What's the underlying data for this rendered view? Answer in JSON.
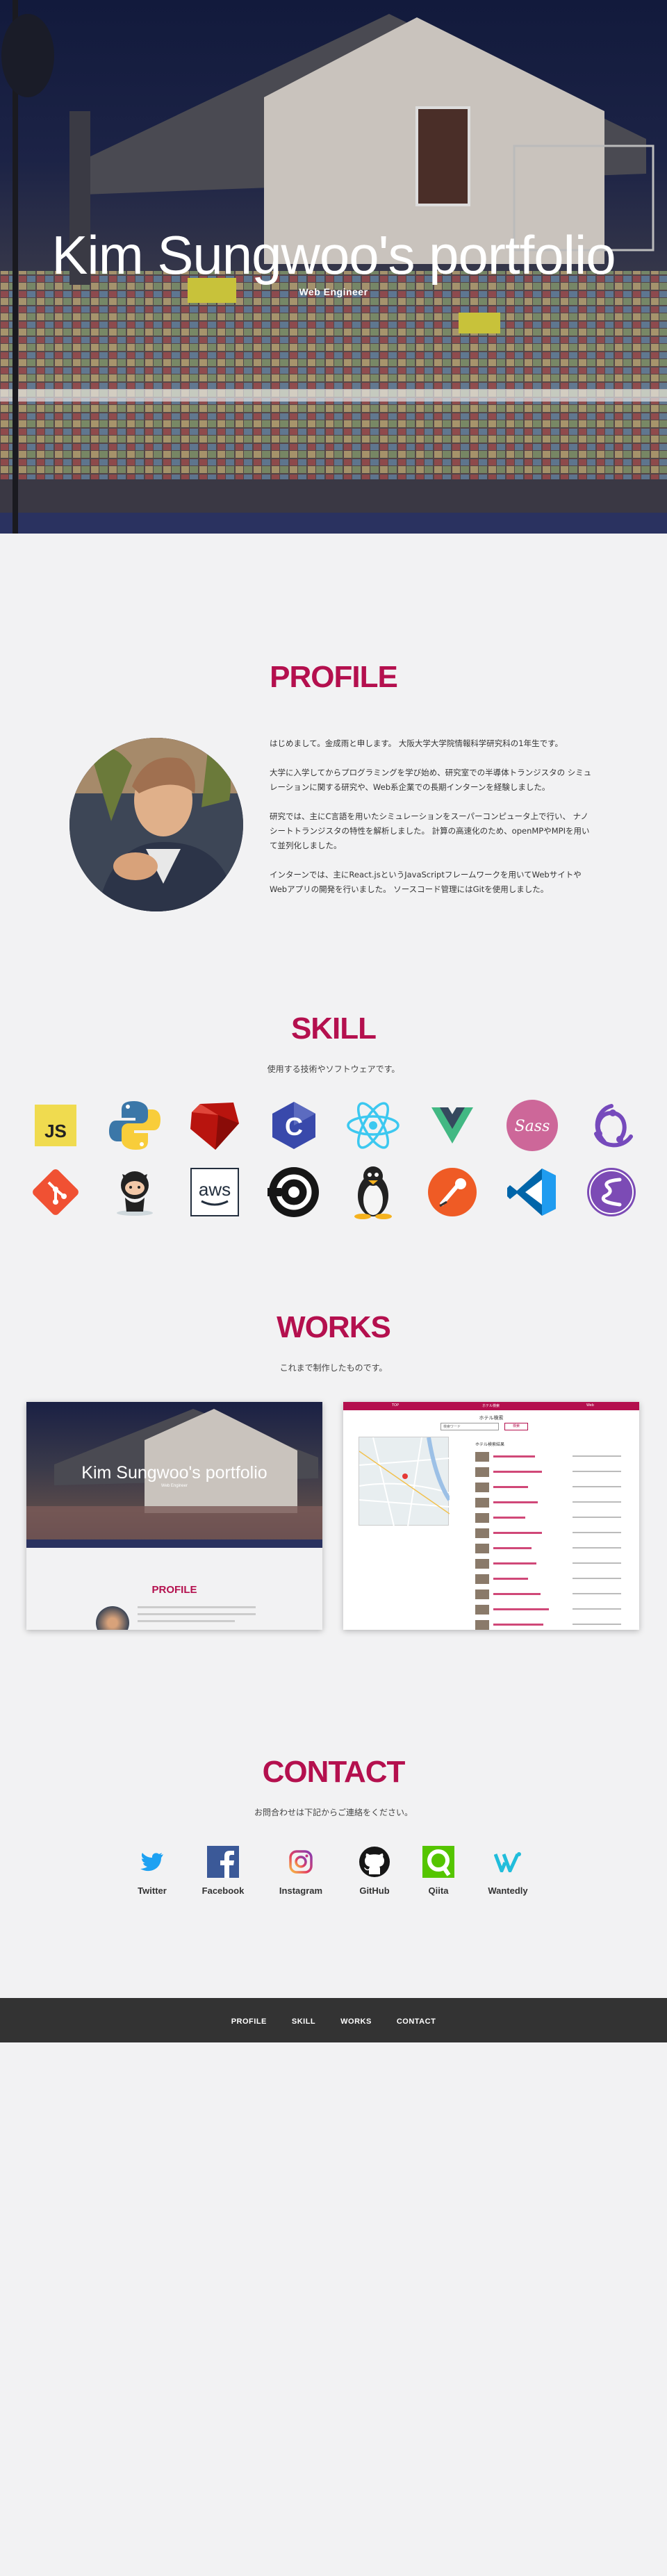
{
  "hero": {
    "title": "Kim Sungwoo's portfolio",
    "subtitle": "Web Engineer"
  },
  "profile": {
    "title": "PROFILE",
    "paragraphs": [
      "はじめまして。金成雨と申します。 大阪大学大学院情報科学研究科の1年生です。",
      "大学に入学してからプログラミングを学び始め、研究室での半導体トランジスタの シミュレーションに関する研究や、Web系企業での長期インターンを経験しました。",
      "研究では、主にC言語を用いたシミュレーションをスーパーコンピュータ上で行い、 ナノシートトランジスタの特性を解析しました。 計算の高速化のため、openMPやMPIを用いて並列化しました。",
      "インターンでは、主にReact.jsというJavaScriptフレームワークを用いてWebサイトや Webアプリの開発を行いました。 ソースコード管理にはGitを使用しました。"
    ]
  },
  "skill": {
    "title": "SKILL",
    "description": "使用する技術やソフトウェアです。",
    "icons_row1": [
      "javascript-icon",
      "python-icon",
      "ruby-icon",
      "c-icon",
      "react-icon",
      "vue-icon",
      "sass-icon",
      "redux-icon"
    ],
    "icons_row2": [
      "git-icon",
      "github-icon",
      "aws-icon",
      "circleci-icon",
      "linux-icon",
      "postman-icon",
      "vscode-icon",
      "emacs-icon"
    ],
    "aws_text": "aws",
    "js_text": "JS"
  },
  "works": {
    "title": "WORKS",
    "description": "これまで制作したものです。",
    "card1": {
      "title": "Kim Sungwoo's portfolio",
      "subtitle": "Web Engineer",
      "section": "PROFILE"
    },
    "card2": {
      "header_left": "TOP",
      "header_center": "ホテル検索",
      "header_right": "Web",
      "title": "ホテル検索",
      "search_placeholder": "検索ワード",
      "search_button": "検索",
      "list_title": "ホテル検索結果"
    }
  },
  "contact": {
    "title": "CONTACT",
    "description": "お問合わせは下記からご連絡をください。",
    "items": [
      {
        "label": "Twitter"
      },
      {
        "label": "Facebook"
      },
      {
        "label": "Instagram"
      },
      {
        "label": "GitHub"
      },
      {
        "label": "Qiita"
      },
      {
        "label": "Wantedly"
      }
    ]
  },
  "footer": {
    "nav": [
      "PROFILE",
      "SKILL",
      "WORKS",
      "CONTACT"
    ]
  },
  "colors": {
    "accent": "#b4104e",
    "footer_bg": "#333333",
    "page_bg": "#f2f2f3"
  }
}
